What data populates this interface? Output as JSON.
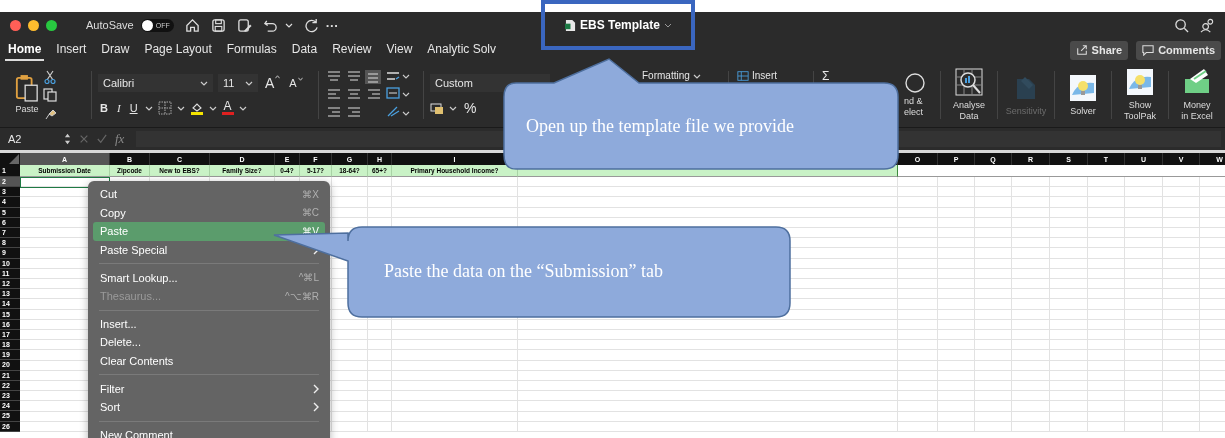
{
  "title_bar": {
    "autosave_label": "AutoSave",
    "autosave": {
      "on": false,
      "text": "OFF"
    },
    "more": "···",
    "document_title": "EBS Template"
  },
  "ribbon_tabs": [
    {
      "label": "Home",
      "selected": true
    },
    {
      "label": "Insert",
      "selected": false
    },
    {
      "label": "Draw",
      "selected": false
    },
    {
      "label": "Page Layout",
      "selected": false
    },
    {
      "label": "Formulas",
      "selected": false
    },
    {
      "label": "Data",
      "selected": false
    },
    {
      "label": "Review",
      "selected": false
    },
    {
      "label": "View",
      "selected": false
    },
    {
      "label": "Analytic Solv",
      "selected": false
    }
  ],
  "share_button": "Share",
  "comments_button": "Comments",
  "ribbon": {
    "paste_label": "Paste",
    "font_name": "Calibri",
    "font_size": "11",
    "grow_font": "A",
    "shrink_font": "A",
    "bold": "B",
    "italic": "I",
    "underline": "U",
    "font_color": "A",
    "number_format": "Custom",
    "percent": "%",
    "conditional_formatting": "Formatting",
    "insert": "Insert",
    "sum": "Σ",
    "find_select": [
      "nd &",
      "elect"
    ],
    "tools": [
      {
        "kind": "analyse",
        "label": [
          "Analyse",
          "Data"
        ],
        "disabled": false
      },
      {
        "kind": "sensitivity",
        "label": [
          "Sensitivity"
        ],
        "disabled": true
      },
      {
        "kind": "solver",
        "label": [
          "Solver"
        ],
        "disabled": false
      },
      {
        "kind": "toolpak",
        "label": [
          "Show",
          "ToolPak"
        ],
        "disabled": false
      },
      {
        "kind": "money",
        "label": [
          "Money",
          "in Excel"
        ],
        "disabled": false
      }
    ]
  },
  "formula_bar": {
    "cell_reference": "A2",
    "fx": "fx"
  },
  "columns_left": [
    {
      "letter": "A",
      "header": "Submission Date",
      "selected": true
    },
    {
      "letter": "B",
      "header": "Zipcode",
      "selected": false
    },
    {
      "letter": "C",
      "header": "New to EBS?",
      "selected": false
    },
    {
      "letter": "D",
      "header": "Family Size?",
      "selected": false
    },
    {
      "letter": "E",
      "header": "0-4?",
      "selected": false
    },
    {
      "letter": "F",
      "header": "5-17?",
      "selected": false
    },
    {
      "letter": "G",
      "header": "18-64?",
      "selected": false
    },
    {
      "letter": "H",
      "header": "65+?",
      "selected": false
    },
    {
      "letter": "I",
      "header": "Primary Household Income?",
      "selected": false
    }
  ],
  "columns_right": [
    {
      "letter": "O",
      "selected": false
    },
    {
      "letter": "P",
      "selected": false
    },
    {
      "letter": "Q",
      "selected": false
    },
    {
      "letter": "R",
      "selected": false
    },
    {
      "letter": "S",
      "selected": false
    },
    {
      "letter": "T",
      "selected": false
    },
    {
      "letter": "U",
      "selected": false
    },
    {
      "letter": "V",
      "selected": false
    },
    {
      "letter": "W",
      "selected": false
    }
  ],
  "rows": [
    {
      "label": "1",
      "selected": false
    },
    {
      "label": "2",
      "selected": true
    },
    {
      "label": "3",
      "selected": false
    },
    {
      "label": "4",
      "selected": false
    },
    {
      "label": "5",
      "selected": false
    },
    {
      "label": "6",
      "selected": false
    },
    {
      "label": "7",
      "selected": false
    },
    {
      "label": "8",
      "selected": false
    },
    {
      "label": "9",
      "selected": false
    },
    {
      "label": "10",
      "selected": false
    },
    {
      "label": "11",
      "selected": false
    },
    {
      "label": "12",
      "selected": false
    },
    {
      "label": "13",
      "selected": false
    },
    {
      "label": "14",
      "selected": false
    },
    {
      "label": "15",
      "selected": false
    },
    {
      "label": "16",
      "selected": false
    },
    {
      "label": "17",
      "selected": false
    },
    {
      "label": "18",
      "selected": false
    },
    {
      "label": "19",
      "selected": false
    },
    {
      "label": "20",
      "selected": false
    },
    {
      "label": "21",
      "selected": false
    },
    {
      "label": "22",
      "selected": false
    },
    {
      "label": "23",
      "selected": false
    },
    {
      "label": "24",
      "selected": false
    },
    {
      "label": "25",
      "selected": false
    },
    {
      "label": "26",
      "selected": false
    }
  ],
  "context_menu": [
    {
      "kind": "item",
      "label": "Cut",
      "shortcut": "⌘X",
      "selected": false,
      "disabled": false,
      "submenu": false
    },
    {
      "kind": "item",
      "label": "Copy",
      "shortcut": "⌘C",
      "selected": false,
      "disabled": false,
      "submenu": false
    },
    {
      "kind": "item",
      "label": "Paste",
      "shortcut": "⌘V",
      "selected": true,
      "disabled": false,
      "submenu": false
    },
    {
      "kind": "item",
      "label": "Paste Special",
      "selected": false,
      "disabled": false,
      "submenu": true
    },
    {
      "kind": "separator"
    },
    {
      "kind": "item",
      "label": "Smart Lookup...",
      "shortcut": "^⌘L",
      "selected": false,
      "disabled": false,
      "submenu": false
    },
    {
      "kind": "item",
      "label": "Thesaurus...",
      "shortcut": "^⌥⌘R",
      "selected": false,
      "disabled": true,
      "submenu": false
    },
    {
      "kind": "separator"
    },
    {
      "kind": "item",
      "label": "Insert...",
      "selected": false,
      "disabled": false,
      "submenu": false
    },
    {
      "kind": "item",
      "label": "Delete...",
      "selected": false,
      "disabled": false,
      "submenu": false
    },
    {
      "kind": "item",
      "label": "Clear Contents",
      "selected": false,
      "disabled": false,
      "submenu": false
    },
    {
      "kind": "separator"
    },
    {
      "kind": "item",
      "label": "Filter",
      "selected": false,
      "disabled": false,
      "submenu": true
    },
    {
      "kind": "item",
      "label": "Sort",
      "selected": false,
      "disabled": false,
      "submenu": true
    },
    {
      "kind": "separator"
    },
    {
      "kind": "item",
      "label": "New Comment",
      "selected": false,
      "disabled": false,
      "submenu": false
    }
  ],
  "callouts": [
    {
      "kind": "top",
      "text": "Open up the template file we provide"
    },
    {
      "kind": "left",
      "text": "Paste the data on the “Submission” tab"
    }
  ]
}
